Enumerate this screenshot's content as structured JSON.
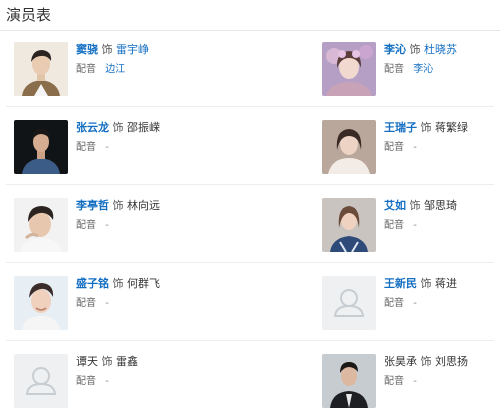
{
  "header": {
    "title": "演员表"
  },
  "cast": [
    {
      "actor": "窦骁",
      "connector": "饰",
      "role": "雷宇峥",
      "dub_label": "配音",
      "dub_value": "边江",
      "photo": "portrait-photo"
    },
    {
      "actor": "李沁",
      "connector": "饰",
      "role": "杜晓苏",
      "dub_label": "配音",
      "dub_value": "李沁",
      "photo": "portrait-photo"
    },
    {
      "actor": "张云龙",
      "connector": "饰",
      "role": "邵振嵘",
      "dub_label": "配音",
      "dub_value": "-",
      "photo": "portrait-photo"
    },
    {
      "actor": "王瑞子",
      "connector": "饰",
      "role": "蒋繁绿",
      "dub_label": "配音",
      "dub_value": "-",
      "photo": "portrait-photo"
    },
    {
      "actor": "李亭哲",
      "connector": "饰",
      "role": "林向远",
      "dub_label": "配音",
      "dub_value": "-",
      "photo": "portrait-photo"
    },
    {
      "actor": "艾如",
      "connector": "饰",
      "role": "邹思琦",
      "dub_label": "配音",
      "dub_value": "-",
      "photo": "portrait-photo"
    },
    {
      "actor": "盛子铭",
      "connector": "饰",
      "role": "何群飞",
      "dub_label": "配音",
      "dub_value": "-",
      "photo": "portrait-photo"
    },
    {
      "actor": "王新民",
      "connector": "饰",
      "role": "蒋进",
      "dub_label": "配音",
      "dub_value": "-",
      "photo": "default-avatar-icon"
    },
    {
      "actor": "谭天",
      "connector": "饰",
      "role": "雷鑫",
      "dub_label": "配音",
      "dub_value": "-",
      "photo": "default-avatar-icon"
    },
    {
      "actor": "张昊承",
      "connector": "饰",
      "role": "刘思扬",
      "dub_label": "配音",
      "dub_value": "-",
      "photo": "portrait-photo"
    }
  ],
  "colors": {
    "link": "#136ec2",
    "text": "#333333",
    "muted": "#666666",
    "divider": "#eeeeee"
  }
}
